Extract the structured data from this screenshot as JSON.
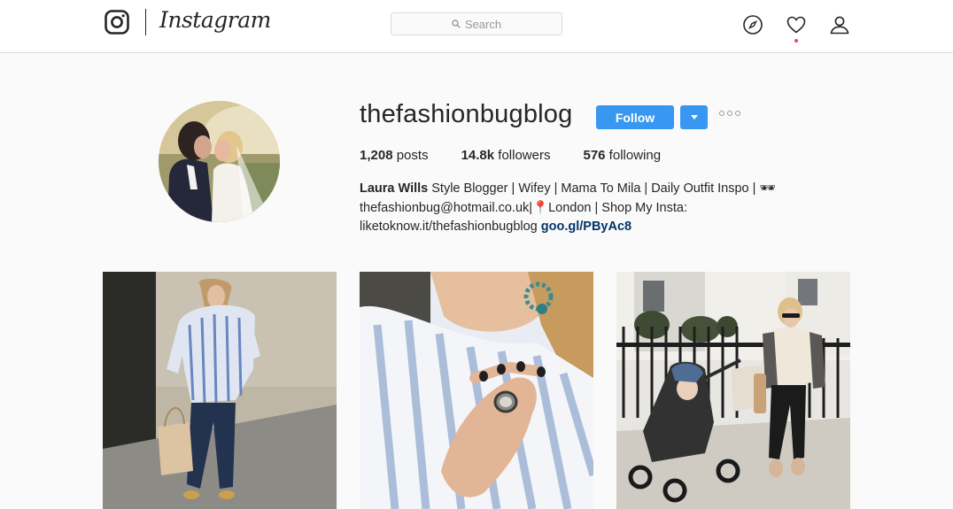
{
  "header": {
    "logo_text": "Instagram",
    "search_placeholder": "Search",
    "icons": [
      "instagram-glyph-icon",
      "compass-icon",
      "heart-icon",
      "user-icon"
    ],
    "notification_dot_color": "#ed4956"
  },
  "profile": {
    "username": "thefashionbugblog",
    "follow_label": "Follow",
    "stats": {
      "posts_count": "1,208",
      "posts_label": " posts",
      "followers_count": "14.8k",
      "followers_label": " followers",
      "following_count": "576",
      "following_label": " following"
    },
    "bio": {
      "name": "Laura Wills",
      "line1": " Style Blogger | Wifey | Mama To Mila | Daily Outfit Inspo | 🕶",
      "line2": "thefashionbug@hotmail.co.uk|📍London | Shop My Insta:",
      "line3": "liketoknow.it/thefashionbugblog ",
      "link": "goo.gl/PByAc8"
    }
  },
  "posts": [
    {
      "alt": "woman in blue striped ruffle blouse and jeans with beige quilted handbag"
    },
    {
      "alt": "close-up of hand with rings on striped blouse and turquoise earring"
    },
    {
      "alt": "woman in striped coat next to stroller on London street"
    }
  ],
  "colors": {
    "accent": "#3897f0",
    "link": "#003569",
    "background": "#fafafa",
    "border": "#dbdbdb"
  }
}
